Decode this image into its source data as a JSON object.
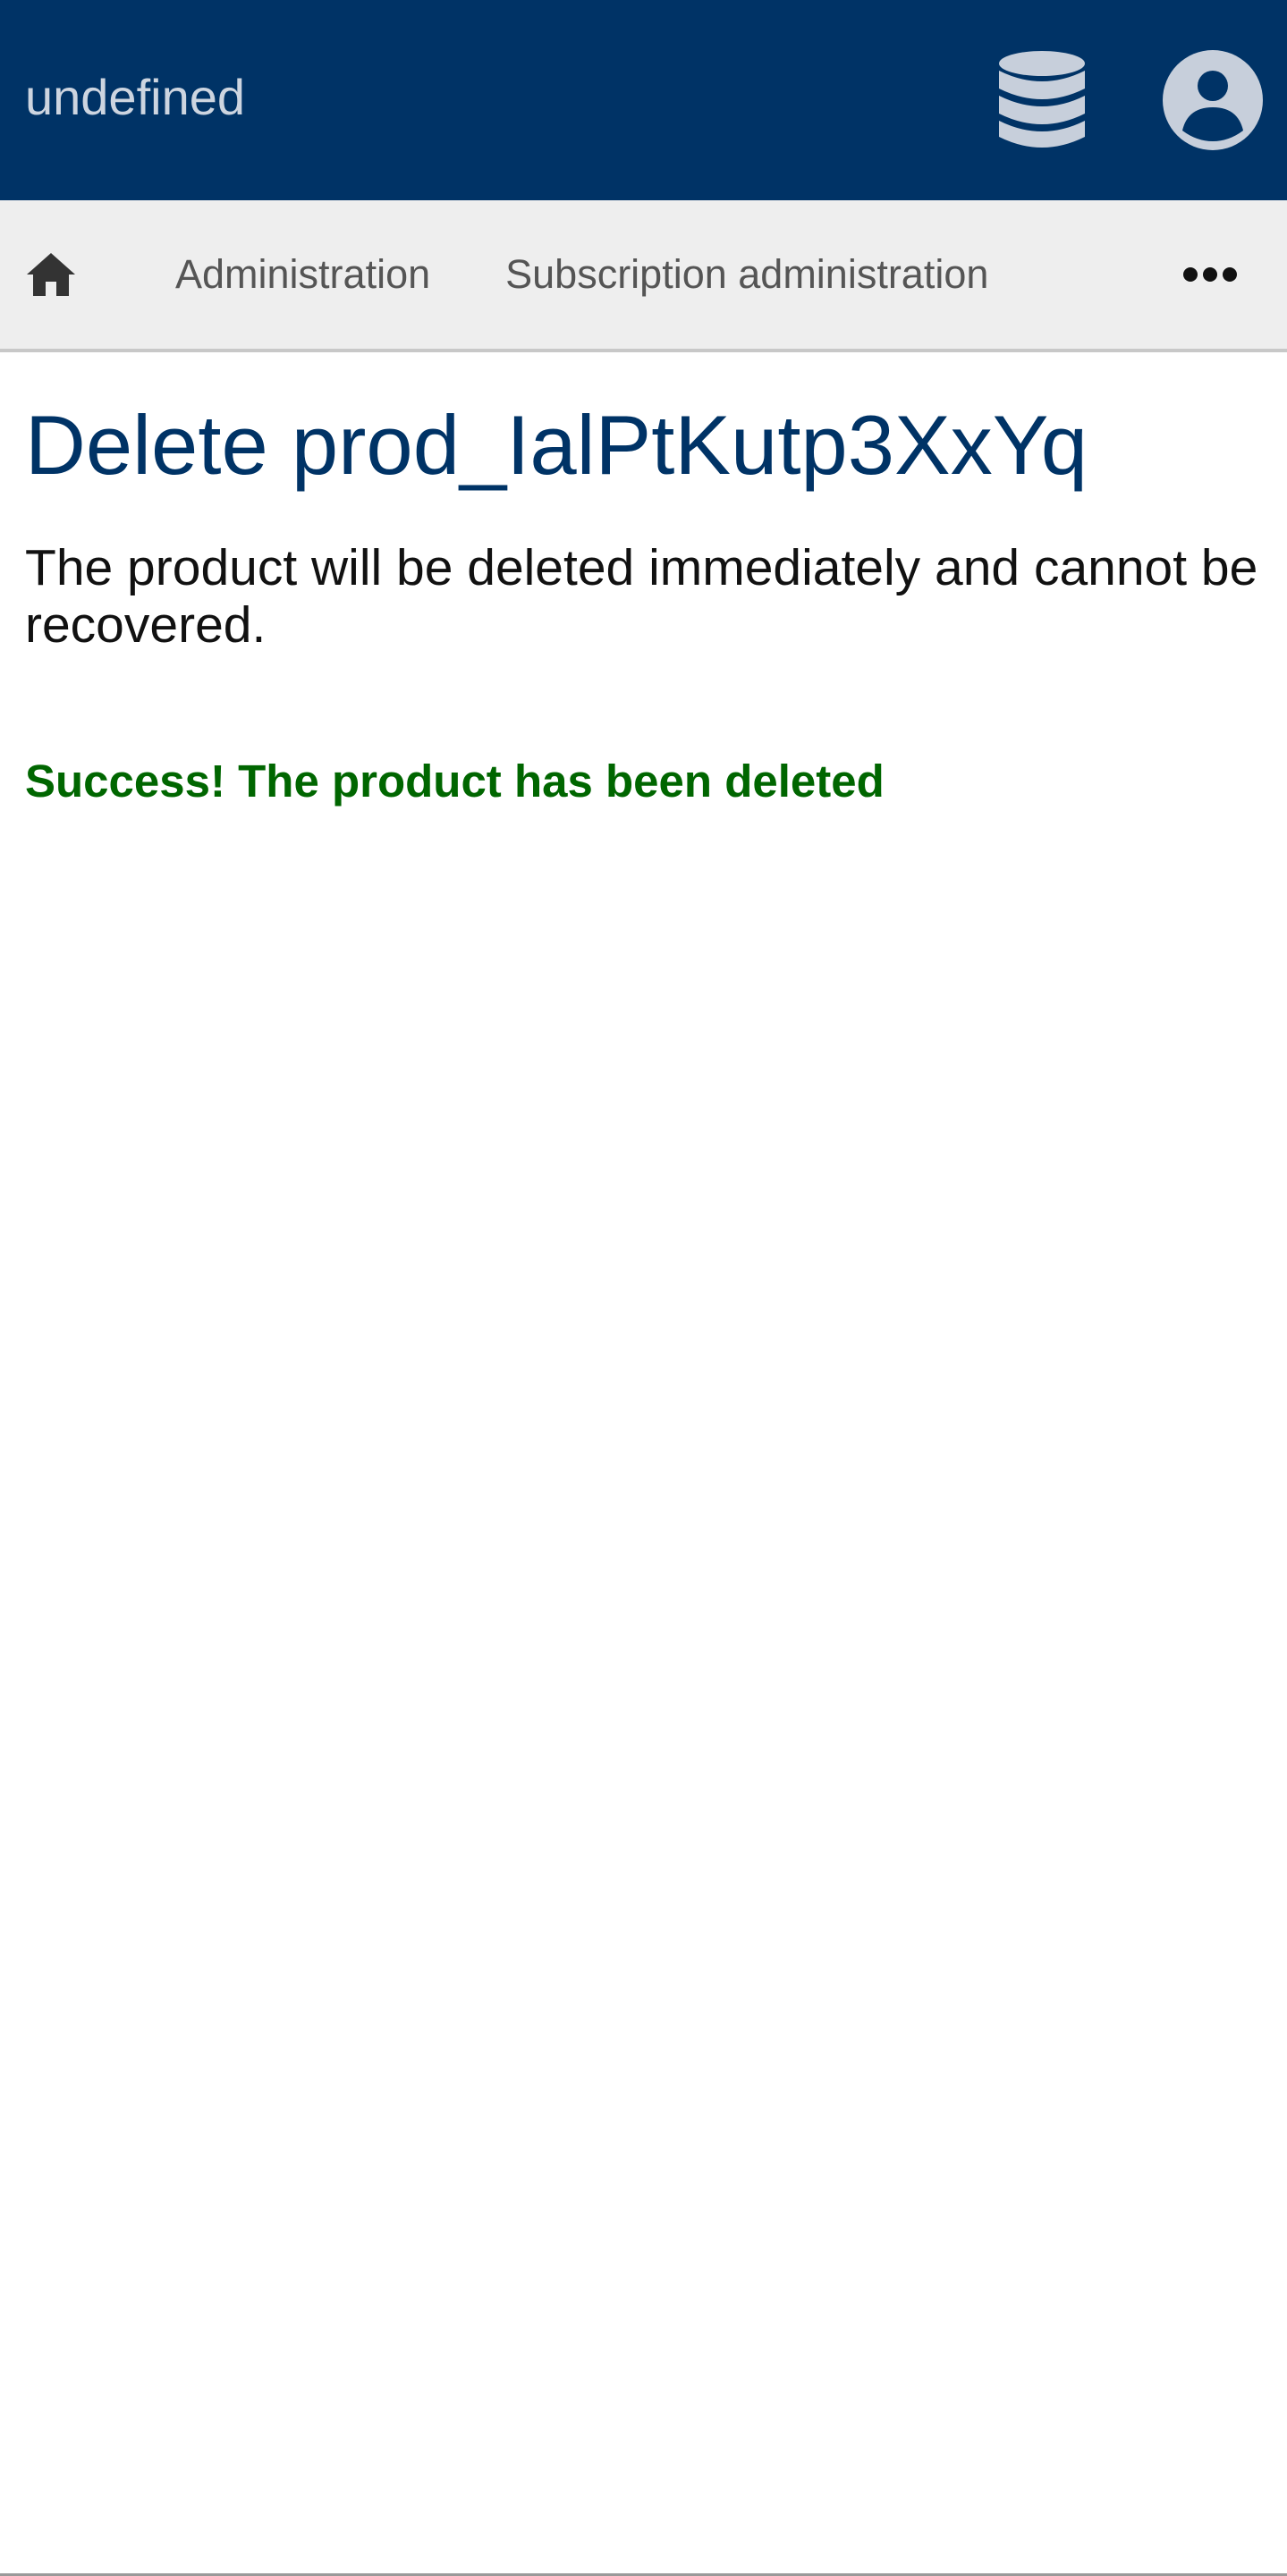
{
  "header": {
    "app_title": "undefined",
    "database_icon": "database-icon",
    "account_icon": "user-circle-icon",
    "background": "#003366"
  },
  "nav": {
    "home_icon": "home-icon",
    "items": [
      {
        "label": "Administration"
      },
      {
        "label": "Subscription administration"
      }
    ],
    "more_icon": "more-horizontal-icon"
  },
  "main": {
    "title": "Delete prod_IalPtKutp3XxYq",
    "description": "The product will be deleted immediately and cannot be recovered.",
    "success_message": "Success! The product has been deleted",
    "title_color": "#003366",
    "success_color": "#006600"
  }
}
